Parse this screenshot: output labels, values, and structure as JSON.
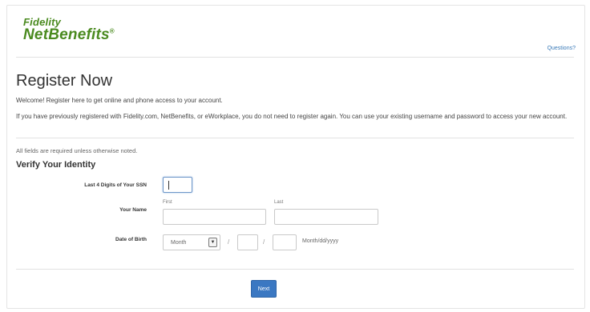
{
  "brand": {
    "line1": "Fidelity",
    "line2": "NetBenefits",
    "mark": "®"
  },
  "header": {
    "questions_link": "Questions?"
  },
  "page": {
    "title": "Register Now",
    "welcome": "Welcome! Register here to get online and phone access to your account.",
    "previous_note": "If you have previously registered with Fidelity.com, NetBenefits, or eWorkplace, you do not need to register again. You can use your existing username and password to access your new account.",
    "required_note": "All fields are required unless otherwise noted."
  },
  "verify": {
    "heading": "Verify Your Identity",
    "ssn_label": "Last 4 Digits of Your SSN",
    "ssn_value": "",
    "name_label": "Your Name",
    "first_sublabel": "First",
    "last_sublabel": "Last",
    "first_value": "",
    "last_value": "",
    "dob_label": "Date of Birth",
    "month_selected": "Month",
    "slash1": "/",
    "slash2": "/",
    "day_value": "",
    "year_value": "",
    "dob_format": "Month/dd/yyyy"
  },
  "actions": {
    "next_label": "Next"
  }
}
